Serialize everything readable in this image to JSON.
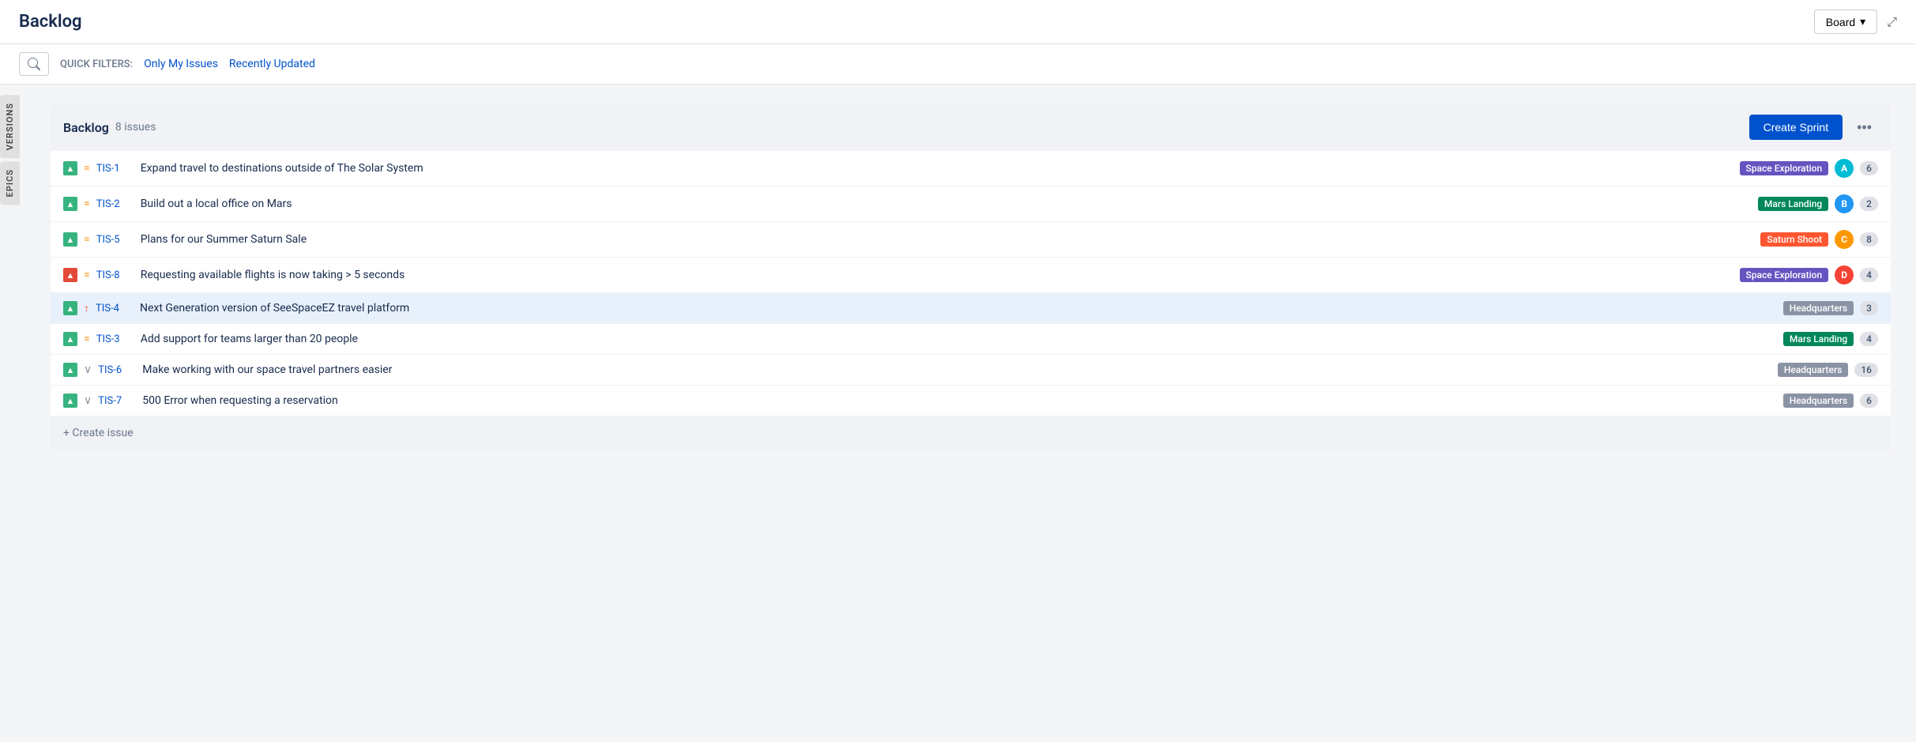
{
  "header": {
    "title": "Backlog",
    "board_button": "Board",
    "expand_icon": "⤢"
  },
  "filters": {
    "quick_filters_label": "QUICK FILTERS:",
    "only_my_issues": "Only My Issues",
    "recently_updated": "Recently Updated"
  },
  "side_tabs": [
    {
      "label": "VERSIONS"
    },
    {
      "label": "EPICS"
    }
  ],
  "backlog": {
    "title": "Backlog",
    "issues_count": "8 issues",
    "create_sprint_btn": "Create Sprint",
    "more_btn": "•••",
    "issues": [
      {
        "id": "TIS-1",
        "title": "Expand travel to destinations outside of The Solar System",
        "epic": "Space Exploration",
        "epic_class": "epic-space",
        "points": "6",
        "priority": "=",
        "priority_class": "normal",
        "type": "story",
        "avatar_text": "A",
        "avatar_class": "avatar-teal"
      },
      {
        "id": "TIS-2",
        "title": "Build out a local office on Mars",
        "epic": "Mars Landing",
        "epic_class": "epic-mars",
        "points": "2",
        "priority": "=",
        "priority_class": "normal",
        "type": "story",
        "avatar_text": "B",
        "avatar_class": "avatar-blue"
      },
      {
        "id": "TIS-5",
        "title": "Plans for our Summer Saturn Sale",
        "epic": "Saturn Shoot",
        "epic_class": "epic-saturn",
        "points": "8",
        "priority": "=",
        "priority_class": "normal",
        "type": "story",
        "avatar_text": "C",
        "avatar_class": "avatar-orange"
      },
      {
        "id": "TIS-8",
        "title": "Requesting available flights is now taking > 5 seconds",
        "epic": "Space Exploration",
        "epic_class": "epic-space",
        "points": "4",
        "priority": "=",
        "priority_class": "normal",
        "type": "bug",
        "avatar_text": "D",
        "avatar_class": "avatar-red"
      },
      {
        "id": "TIS-4",
        "title": "Next Generation version of SeeSpaceEZ travel platform",
        "epic": "Headquarters",
        "epic_class": "epic-hq",
        "points": "3",
        "priority": "↑",
        "priority_class": "high",
        "type": "story",
        "highlighted": true
      },
      {
        "id": "TIS-3",
        "title": "Add support for teams larger than 20 people",
        "epic": "Mars Landing",
        "epic_class": "epic-mars",
        "points": "4",
        "priority": "=",
        "priority_class": "normal",
        "type": "story"
      },
      {
        "id": "TIS-6",
        "title": "Make working with our space travel partners easier",
        "epic": "Headquarters",
        "epic_class": "epic-hq",
        "points": "16",
        "priority": "~",
        "priority_class": "low",
        "type": "story"
      },
      {
        "id": "TIS-7",
        "title": "500 Error when requesting a reservation",
        "epic": "Headquarters",
        "epic_class": "epic-hq",
        "points": "6",
        "priority": "~",
        "priority_class": "low",
        "type": "story"
      }
    ],
    "create_issue_label": "+ Create issue"
  }
}
